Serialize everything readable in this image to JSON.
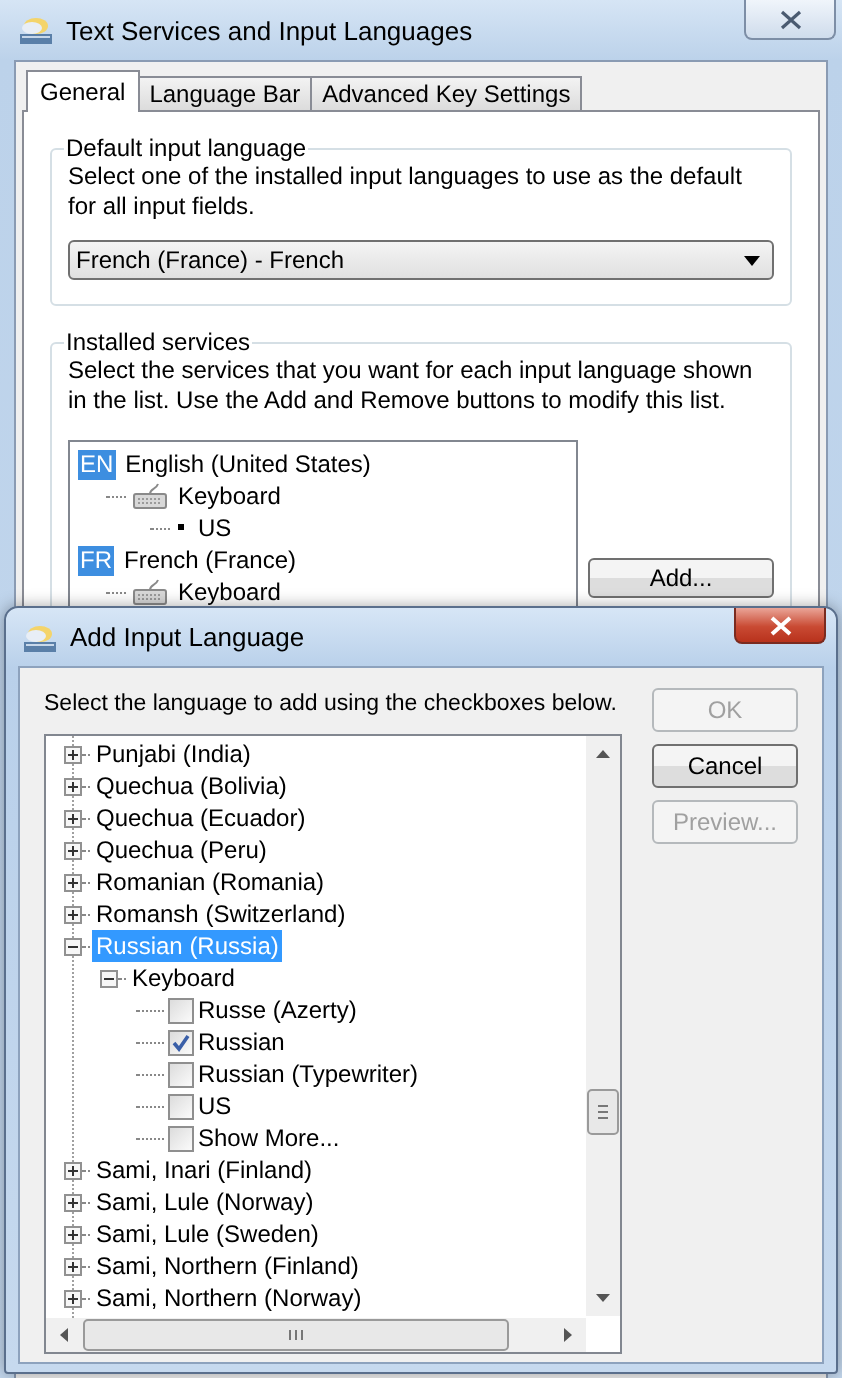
{
  "main_window": {
    "title": "Text Services and Input Languages",
    "tabs": [
      {
        "label": "General",
        "selected": true
      },
      {
        "label": "Language Bar",
        "selected": false
      },
      {
        "label": "Advanced Key Settings",
        "selected": false
      }
    ],
    "default_input_language": {
      "heading": "Default input language",
      "description": "Select one of the installed input languages to use as the default for all input fields.",
      "value": "French (France) - French"
    },
    "installed_services": {
      "heading": "Installed services",
      "description": "Select the services that you want for each input language shown in the list. Use the Add and Remove buttons to modify this list.",
      "languages": [
        {
          "kind": "language",
          "code": "EN",
          "name": "English (United States)",
          "children": [
            {
              "kind": "input_method",
              "name": "Keyboard",
              "children": [
                {
                  "kind": "layout",
                  "name": "US"
                }
              ]
            }
          ]
        },
        {
          "kind": "language",
          "code": "FR",
          "name": "French (France)",
          "children": [
            {
              "kind": "input_method",
              "name": "Keyboard"
            }
          ]
        }
      ],
      "buttons": [
        "Add..."
      ]
    }
  },
  "dialog": {
    "title": "Add Input Language",
    "instruction": "Select the language to add using the checkboxes below.",
    "buttons": [
      {
        "label": "OK",
        "disabled": true
      },
      {
        "label": "Cancel",
        "disabled": false
      },
      {
        "label": "Preview...",
        "disabled": true
      }
    ],
    "tree": [
      {
        "name": "Punjabi (India)",
        "expanded": false,
        "selected": false
      },
      {
        "name": "Quechua (Bolivia)",
        "expanded": false,
        "selected": false
      },
      {
        "name": "Quechua (Ecuador)",
        "expanded": false,
        "selected": false
      },
      {
        "name": "Quechua (Peru)",
        "expanded": false,
        "selected": false
      },
      {
        "name": "Romanian (Romania)",
        "expanded": false,
        "selected": false
      },
      {
        "name": "Romansh (Switzerland)",
        "expanded": false,
        "selected": false
      },
      {
        "name": "Russian (Russia)",
        "expanded": true,
        "selected": true,
        "children": [
          {
            "name": "Keyboard",
            "expanded": true,
            "children": [
              {
                "name": "Russe (Azerty)",
                "checked": false
              },
              {
                "name": "Russian",
                "checked": true
              },
              {
                "name": "Russian (Typewriter)",
                "checked": false
              },
              {
                "name": "US",
                "checked": false
              },
              {
                "name": "Show More...",
                "checked": false
              }
            ]
          }
        ]
      },
      {
        "name": "Sami, Inari (Finland)",
        "expanded": false,
        "selected": false
      },
      {
        "name": "Sami, Lule (Norway)",
        "expanded": false,
        "selected": false
      },
      {
        "name": "Sami, Lule (Sweden)",
        "expanded": false,
        "selected": false
      },
      {
        "name": "Sami, Northern (Finland)",
        "expanded": false,
        "selected": false
      },
      {
        "name": "Sami, Northern (Norway)",
        "expanded": false,
        "selected": false
      }
    ]
  }
}
